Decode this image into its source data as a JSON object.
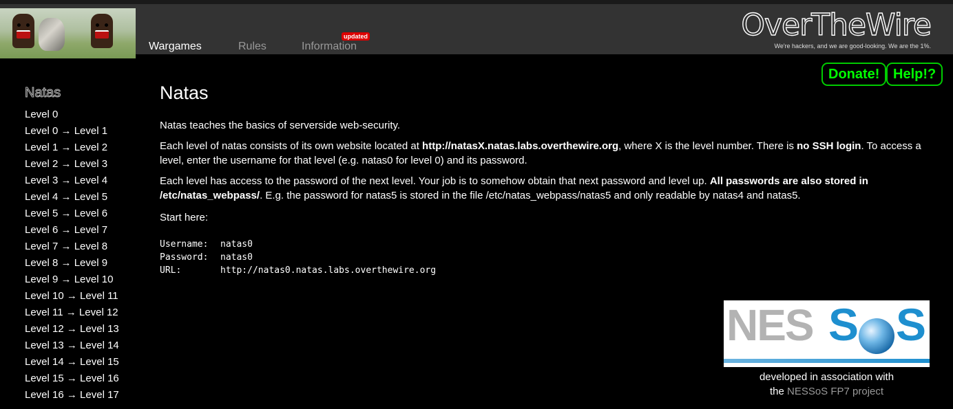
{
  "header": {
    "nav": [
      {
        "label": "Wargames",
        "active": true
      },
      {
        "label": "Rules",
        "active": false
      },
      {
        "label": "Information",
        "active": false
      }
    ],
    "badge": "updated",
    "logo_text": "OverTheWire",
    "tagline": "We're hackers, and we are good-looking. We are the 1%."
  },
  "buttons": {
    "donate": "Donate!",
    "help": "Help!?"
  },
  "sidebar": {
    "title": "Natas",
    "items": [
      "Level 0",
      "Level 0 → Level 1",
      "Level 1 → Level 2",
      "Level 2 → Level 3",
      "Level 3 → Level 4",
      "Level 4 → Level 5",
      "Level 5 → Level 6",
      "Level 6 → Level 7",
      "Level 7 → Level 8",
      "Level 8 → Level 9",
      "Level 9 → Level 10",
      "Level 10 → Level 11",
      "Level 11 → Level 12",
      "Level 12 → Level 13",
      "Level 13 → Level 14",
      "Level 14 → Level 15",
      "Level 15 → Level 16",
      "Level 16 → Level 17"
    ]
  },
  "main": {
    "title": "Natas",
    "intro": "Natas teaches the basics of serverside web-security.",
    "p2": {
      "a": "Each level of natas consists of its own website located at ",
      "b1": "http://natasX.natas.labs.overthewire.org",
      "c": ", where X is the level number. There is ",
      "b2": "no SSH login",
      "d": ". To access a level, enter the username for that level (e.g. natas0 for level 0) and its password."
    },
    "p3": {
      "a": "Each level has access to the password of the next level. Your job is to somehow obtain that next password and level up. ",
      "b1": "All passwords are also stored in /etc/natas_webpass/",
      "c": ". E.g. the password for natas5 is stored in the file /etc/natas_webpass/natas5 and only readable by natas4 and natas5."
    },
    "start": "Start here:",
    "creds": [
      {
        "key": "Username:",
        "value": "natas0"
      },
      {
        "key": "Password:",
        "value": "natas0"
      },
      {
        "key": "URL:",
        "value": "http://natas0.natas.labs.overthewire.org"
      }
    ]
  },
  "sponsor": {
    "logo_ne": "NES",
    "logo_s1": "S",
    "logo_s2": "S",
    "caption_line1": "developed in association with",
    "caption_the": "the ",
    "caption_link": "NESSoS FP7 project"
  }
}
